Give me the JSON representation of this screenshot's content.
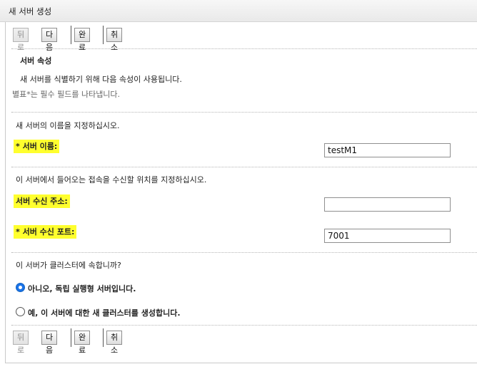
{
  "title": "새 서버 생성",
  "toolbar": {
    "back_label": "뒤로",
    "next_label": "다음",
    "finish_label": "완료",
    "cancel_label": "취소"
  },
  "section": {
    "heading": "서버 속성",
    "description": "새 서버를 식별하기 위해 다음 속성이 사용됩니다.",
    "required_note": "별표*는 필수 필드를 나타냅니다."
  },
  "name_prompt": "새 서버의 이름을 지정하십시오.",
  "server_name": {
    "label": "* 서버 이름:",
    "value": "testM1"
  },
  "listen_prompt": "이 서버에서 들어오는 접속을 수신할 위치를 지정하십시오.",
  "listen_address": {
    "label": "서버 수신 주소:",
    "value": ""
  },
  "listen_port": {
    "label": "* 서버 수신 포트:",
    "value": "7001"
  },
  "cluster_prompt": "이 서버가 클러스터에 속합니까?",
  "cluster_options": [
    {
      "label": "아니오, 독립 실행형 서버입니다.",
      "selected": true
    },
    {
      "label": "예, 이 서버에 대한 새 클러스터를 생성합니다.",
      "selected": false
    }
  ],
  "colors": {
    "highlight": "#ffff2e",
    "radio_selected": "#1a73e8"
  }
}
